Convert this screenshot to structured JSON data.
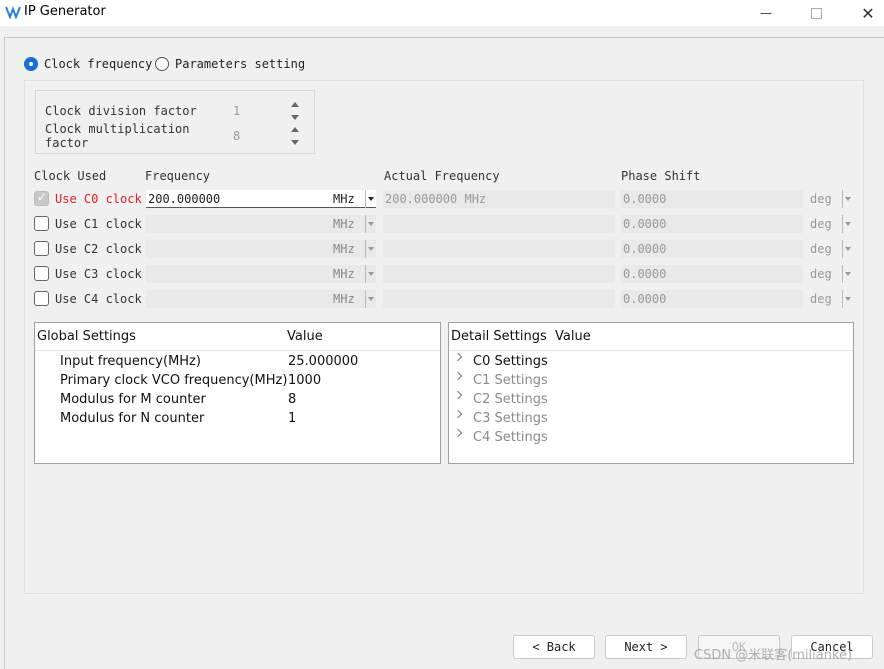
{
  "window": {
    "title": "IP Generator"
  },
  "mode": {
    "clock_frequency": "Clock frequency",
    "parameters_setting": "Parameters setting",
    "selected": "clock_frequency"
  },
  "factors": [
    {
      "label": "Clock division factor",
      "value": "1"
    },
    {
      "label": "Clock multiplication factor",
      "value": "8"
    }
  ],
  "columns": {
    "clock_used": "Clock Used",
    "frequency": "Frequency",
    "actual_frequency": "Actual Frequency",
    "phase_shift": "Phase Shift"
  },
  "clocks": [
    {
      "label": "Use C0 clock",
      "checked": true,
      "frequency": "200.000000",
      "unit": "MHz",
      "actual": "200.000000 MHz",
      "phase": "0.0000",
      "phase_unit": "deg"
    },
    {
      "label": "Use C1 clock",
      "checked": false,
      "frequency": "",
      "unit": "MHz",
      "actual": "",
      "phase": "0.0000",
      "phase_unit": "deg"
    },
    {
      "label": "Use C2 clock",
      "checked": false,
      "frequency": "",
      "unit": "MHz",
      "actual": "",
      "phase": "0.0000",
      "phase_unit": "deg"
    },
    {
      "label": "Use C3 clock",
      "checked": false,
      "frequency": "",
      "unit": "MHz",
      "actual": "",
      "phase": "0.0000",
      "phase_unit": "deg"
    },
    {
      "label": "Use C4 clock",
      "checked": false,
      "frequency": "",
      "unit": "MHz",
      "actual": "",
      "phase": "0.0000",
      "phase_unit": "deg"
    }
  ],
  "global_settings": {
    "headers": [
      "Global Settings",
      "Value"
    ],
    "rows": [
      {
        "name": "Input frequency(MHz)",
        "value": "25.000000"
      },
      {
        "name": "Primary clock VCO frequency(MHz)",
        "value": "1000"
      },
      {
        "name": "Modulus for M counter",
        "value": "8"
      },
      {
        "name": "Modulus for N counter",
        "value": "1"
      }
    ]
  },
  "detail_settings": {
    "headers": [
      "Detail Settings",
      "Value"
    ],
    "items": [
      "C0 Settings",
      "C1 Settings",
      "C2 Settings",
      "C3 Settings",
      "C4 Settings"
    ]
  },
  "buttons": {
    "back": "< Back",
    "next": "Next >",
    "ok": "OK",
    "cancel": "Cancel"
  },
  "watermark": "CSDN @米联客(milianke)",
  "colors": {
    "accent": "#1a6fd1",
    "active_clock_label": "#e02020"
  }
}
